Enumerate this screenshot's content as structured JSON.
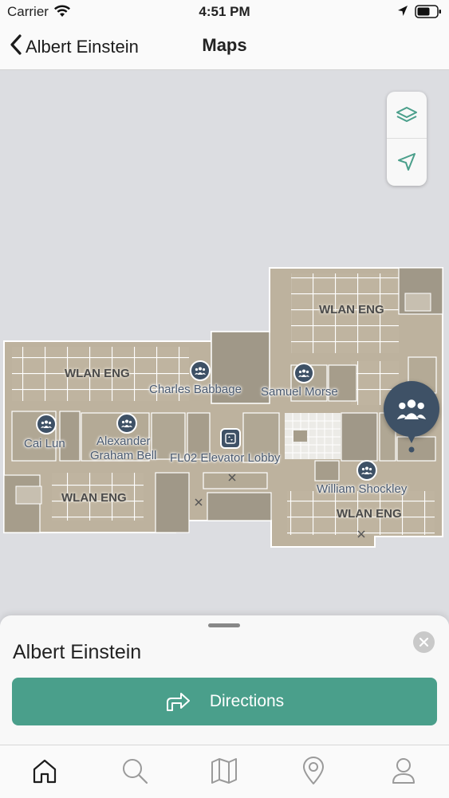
{
  "status_bar": {
    "carrier": "Carrier",
    "time": "4:51 PM"
  },
  "nav": {
    "back_label": "Albert Einstein",
    "title": "Maps"
  },
  "map": {
    "zone_labels": [
      "WLAN ENG",
      "WLAN ENG",
      "WLAN ENG",
      "WLAN ENG"
    ],
    "rooms": {
      "charles_babbage": "Charles Babbage",
      "samuel_morse": "Samuel Morse",
      "cai_lun": "Cai Lun",
      "alexander_line1": "Alexander",
      "alexander_line2": "Graham Bell",
      "elevator_lobby": "FL02 Elevator Lobby",
      "william_shockley": "William Shockley"
    }
  },
  "sheet": {
    "title": "Albert Einstein",
    "directions_label": "Directions"
  },
  "colors": {
    "accent": "#4a9f8b",
    "pin": "#3e5166",
    "floor": "#bfb4a0",
    "map_bg": "#dcdde1"
  },
  "icons": [
    "wifi-icon",
    "location-arrow-icon",
    "battery-icon",
    "chevron-left-icon",
    "layers-icon",
    "navigate-icon",
    "group-icon",
    "elevator-icon",
    "close-icon",
    "directions-arrow-icon",
    "home-icon",
    "search-icon",
    "map-icon",
    "pin-icon",
    "profile-icon"
  ]
}
